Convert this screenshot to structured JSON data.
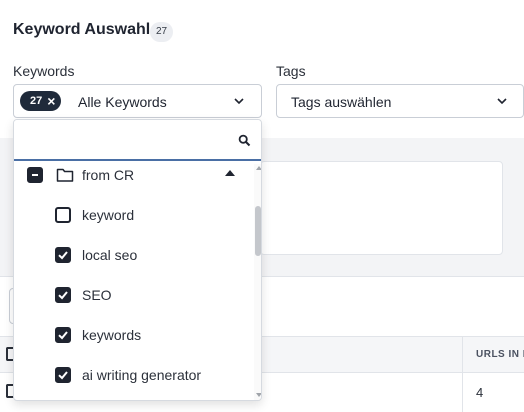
{
  "header": {
    "title": "Keyword Auswahl",
    "count": "27"
  },
  "keywords_field": {
    "label": "Keywords",
    "chip_count": "27",
    "chip_remove": "×",
    "value": "Alle Keywords"
  },
  "tags_field": {
    "label": "Tags",
    "placeholder": "Tags auswählen"
  },
  "dropdown": {
    "search_placeholder": "",
    "group": {
      "label": "from CR",
      "state": "partial",
      "expanded": true
    },
    "options": [
      {
        "label": "keyword",
        "checked": false
      },
      {
        "label": "local seo",
        "checked": true
      },
      {
        "label": "SEO",
        "checked": true
      },
      {
        "label": "keywords",
        "checked": true
      },
      {
        "label": "ai writing generator",
        "checked": true
      }
    ]
  },
  "table": {
    "column_header": "URLS IN I",
    "first_row_value": "4"
  },
  "colors": {
    "text": "#1f2430",
    "chip_bg": "#1f2a3a",
    "focus_border": "#4a6fa5",
    "background_gray": "#f3f4f6"
  }
}
